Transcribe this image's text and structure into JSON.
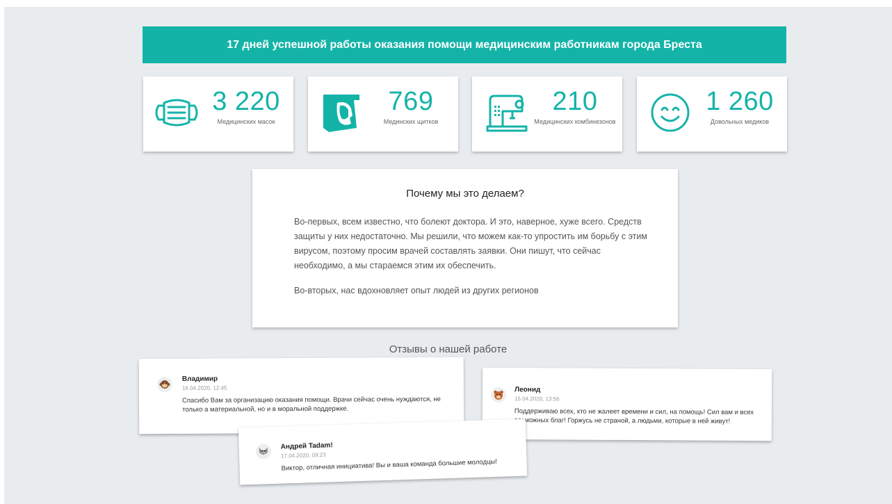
{
  "banner": {
    "text": "17 дней успешной работы оказания помощи медицинским работникам города Бреста"
  },
  "stats": [
    {
      "icon": "mask-icon",
      "value": "3 220",
      "label": "Медицинских масок"
    },
    {
      "icon": "face-shield-icon",
      "value": "769",
      "label": "Мединских щитков"
    },
    {
      "icon": "sewing-machine-icon",
      "value": "210",
      "label": "Медицинских комбинезонов"
    },
    {
      "icon": "smiley-icon",
      "value": "1 260",
      "label": "Довольных медиков"
    }
  ],
  "why": {
    "title": "Почему мы это делаем?",
    "paragraph1": "Во-первых, всем известно, что болеют доктора. И это, наверное, хуже всего. Средств защиты у них недостаточно. Мы решили, что можем как-то упростить им борьбу с этим вирусом, поэтому просим врачей составлять заявки. Они пишут, что сейчас необходимо, а мы стараемся этим их обеспечить.",
    "paragraph2": "Во-вторых, нас вдохновляет опыт людей из других регионов"
  },
  "reviews": {
    "title": "Отзывы о нашей работе",
    "items": [
      {
        "avatar": "monkey-icon",
        "name": "Владимир",
        "date": "16.04.2020, 12:45",
        "text": "Спасибо Вам за организацию оказания помощи. Врачи сейчас очень нуждаются, не только а материальной, но и в моральной поддержке."
      },
      {
        "avatar": "bear-icon",
        "name": "Леонид",
        "date": "15.04.2020, 13:56",
        "text": "Поддерживаю всех, кто не жалеет времени и сил, на помощь! Сил вам и всех возможных благ! Горжусь не страной, а людьми, которые в ней живут!"
      },
      {
        "avatar": "wolf-icon",
        "name": "Андрей Tadam!",
        "date": "17.04.2020, 09:23",
        "text": "Виктор, отличная инициатива! Вы и ваша команда большие молодцы!"
      }
    ]
  },
  "colors": {
    "accent": "#14b3a8",
    "background": "#e9ecef"
  }
}
